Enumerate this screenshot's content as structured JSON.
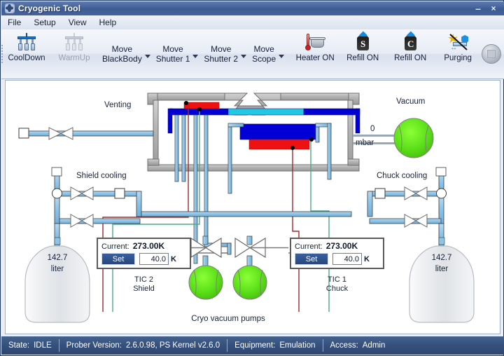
{
  "window": {
    "title": "Cryogenic Tool",
    "icon": "app-gear-icon",
    "minimize_label": "–",
    "close_label": "×"
  },
  "menu": {
    "items": [
      {
        "label": "File"
      },
      {
        "label": "Setup"
      },
      {
        "label": "View"
      },
      {
        "label": "Help"
      }
    ]
  },
  "toolbar": {
    "buttons": [
      {
        "label": "CoolDown",
        "icon": "cooldown-icon",
        "enabled": true
      },
      {
        "label": "WarmUp",
        "icon": "warmup-icon",
        "enabled": false
      }
    ],
    "split_buttons": [
      {
        "line1": "Move",
        "line2": "BlackBody",
        "icon": "chevron-down-icon"
      },
      {
        "line1": "Move",
        "line2": "Shutter 1",
        "icon": "chevron-down-icon"
      },
      {
        "line1": "Move",
        "line2": "Shutter 2",
        "icon": "chevron-down-icon"
      },
      {
        "line1": "Move",
        "line2": "Scope",
        "icon": "chevron-down-icon"
      }
    ],
    "right_buttons": [
      {
        "label": "Heater ON",
        "icon": "heater-icon"
      },
      {
        "label": "Refill ON",
        "icon": "refill-shield-icon",
        "glyph": "S"
      },
      {
        "label": "Refill ON",
        "icon": "refill-chuck-icon",
        "glyph": "C"
      },
      {
        "label": "Purging",
        "icon": "purging-icon"
      }
    ],
    "stop_button": {
      "name": "stop-button",
      "icon": "stop-square-icon"
    }
  },
  "diagram": {
    "labels": {
      "venting": "Venting",
      "vacuum": "Vacuum",
      "vacuum_value": "0",
      "vacuum_unit": "mbar",
      "shield_cooling": "Shield cooling",
      "chuck_cooling": "Chuck cooling",
      "cryo_pumps": "Cryo vacuum pumps"
    },
    "dewars": [
      {
        "name": "shield-dewar",
        "value": "142.7",
        "unit": "liter"
      },
      {
        "name": "chuck-dewar",
        "value": "142.7",
        "unit": "liter"
      }
    ],
    "tic_panels": [
      {
        "name": "tic-2-shield",
        "current_label": "Current:",
        "current_value": "273.00K",
        "set_label": "Set",
        "target_value": "40.0",
        "target_unit": "K",
        "caption_line1": "TIC 2",
        "caption_line2": "Shield"
      },
      {
        "name": "tic-1-chuck",
        "current_label": "Current:",
        "current_value": "273.00K",
        "set_label": "Set",
        "target_value": "40.0",
        "target_unit": "K",
        "caption_line1": "TIC 1",
        "caption_line2": "Chuck"
      }
    ],
    "colors": {
      "pipe": "#8ec4e8",
      "pipe_outline": "#3c3c3c",
      "gauge_green": "#5ce019",
      "chamber_gray": "#b3b3b3",
      "blue_plate": "#0000d6",
      "cyan_plate": "#1ec8e6",
      "red_plate": "#ef1111",
      "sensor_red": "#9e2b2b",
      "sensor_green": "#4fa887"
    }
  },
  "statusbar": {
    "cells": [
      {
        "key": "State:",
        "value": "IDLE"
      },
      {
        "key": "Prober Version:",
        "value": "2.6.0.98, PS Kernel v2.6.0"
      },
      {
        "key": "Equipment:",
        "value": "Emulation"
      },
      {
        "key": "Access:",
        "value": "Admin"
      }
    ]
  }
}
